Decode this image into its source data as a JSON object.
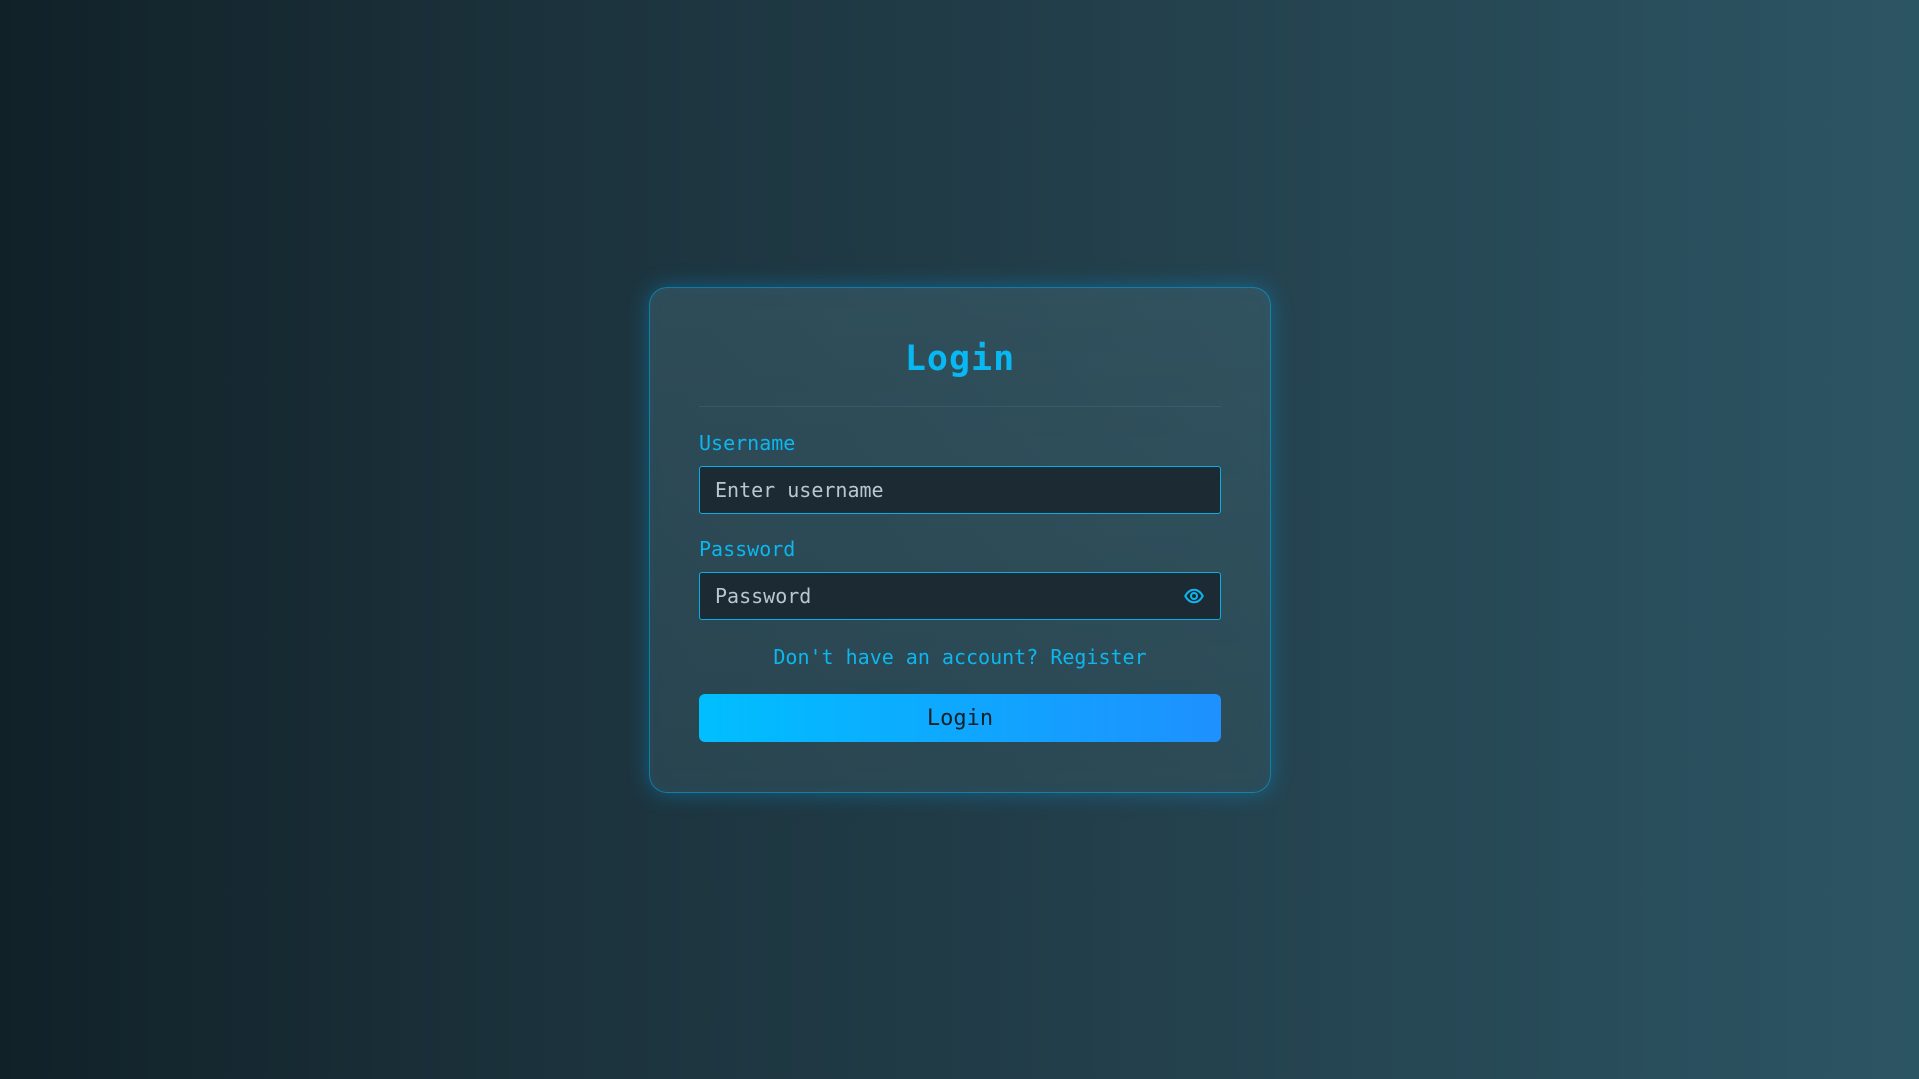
{
  "login_form": {
    "title": "Login",
    "username_label": "Username",
    "username_placeholder": "Enter username",
    "username_value": "",
    "password_label": "Password",
    "password_placeholder": "Password",
    "password_value": "",
    "password_toggle_icon": "eye-icon",
    "register_prompt": "Don't have an account?",
    "register_link": "Register",
    "submit_label": "Login"
  },
  "colors": {
    "accent": "#0cb6ee",
    "button_gradient_start": "#00bfff",
    "button_gradient_end": "#1e90ff",
    "input_background": "#1c2a33",
    "page_background_dark": "#112128",
    "page_background_light": "#2c5564"
  }
}
